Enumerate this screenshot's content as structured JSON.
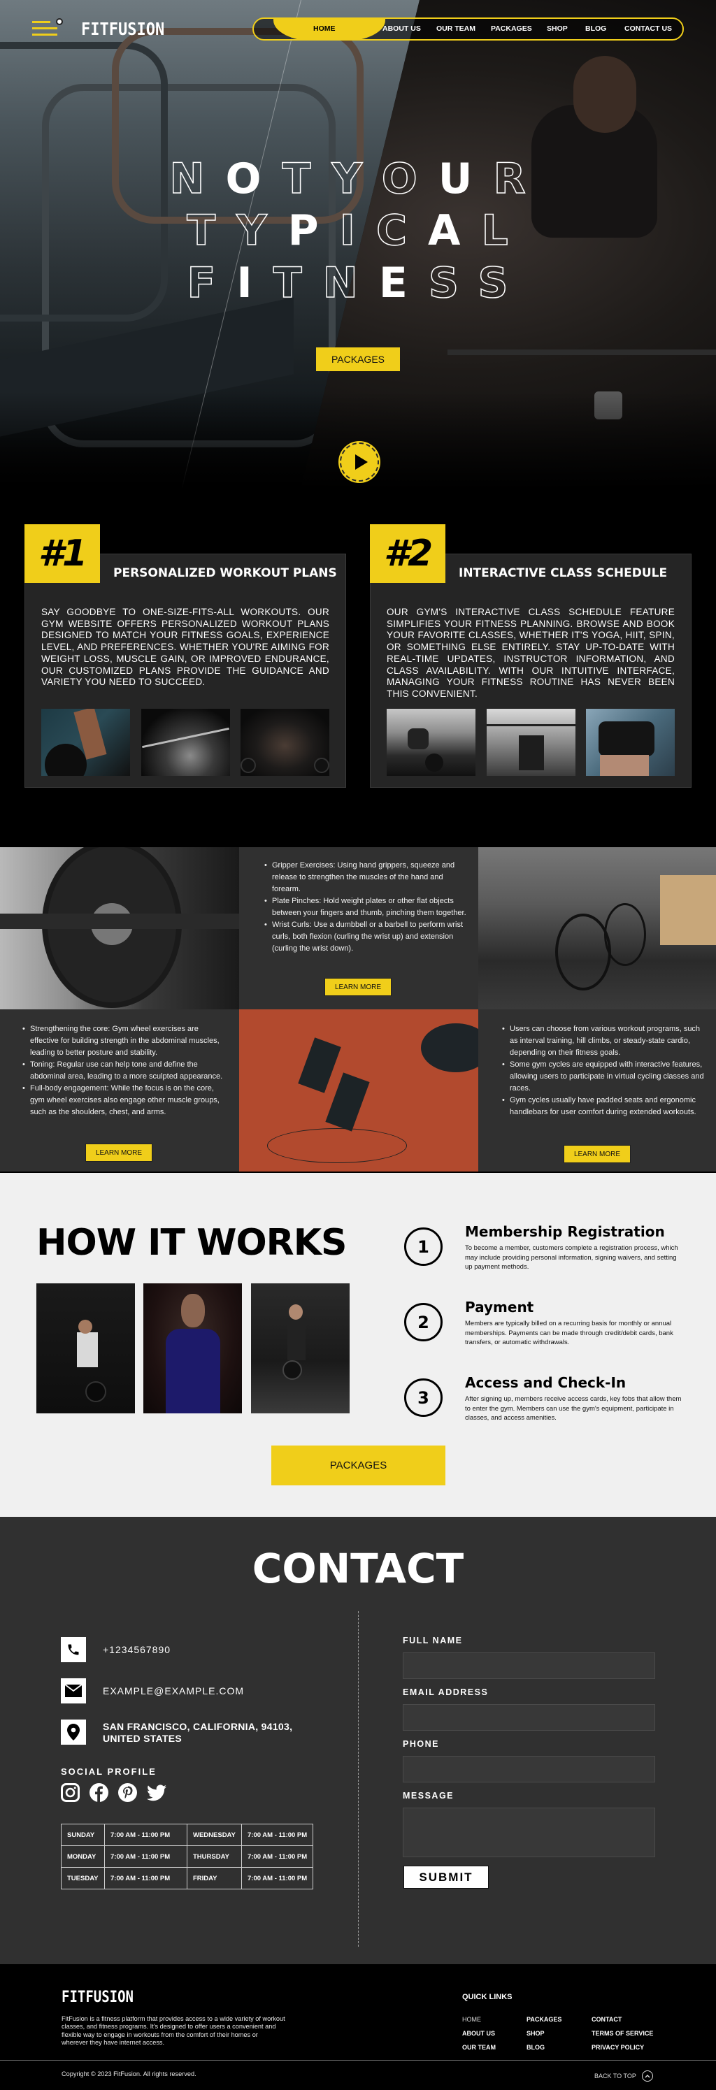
{
  "brand": {
    "name": "FITFUSION",
    "accent": "#f0ce1a"
  },
  "nav": {
    "items": [
      {
        "label": "HOME",
        "active": true
      },
      {
        "label": "ABOUT US",
        "active": false
      },
      {
        "label": "OUR TEAM",
        "active": false
      },
      {
        "label": "PACKAGES",
        "active": false
      },
      {
        "label": "SHOP",
        "active": false
      },
      {
        "label": "BLOG",
        "active": false
      },
      {
        "label": "CONTACT US",
        "active": false
      }
    ],
    "menu_icon": "hamburger-icon"
  },
  "hero": {
    "title_lines": [
      {
        "letters": [
          "N",
          "O",
          "T",
          "Y",
          "O",
          "U",
          "R"
        ],
        "filled": [
          false,
          true,
          false,
          false,
          false,
          true,
          false
        ]
      },
      {
        "letters": [
          "T",
          "Y",
          "P",
          "I",
          "C",
          "A",
          "L"
        ],
        "filled": [
          false,
          false,
          true,
          false,
          false,
          true,
          false
        ]
      },
      {
        "letters": [
          "F",
          "I",
          "T",
          "N",
          "E",
          "S",
          "S"
        ],
        "filled": [
          false,
          true,
          false,
          false,
          true,
          false,
          false
        ]
      }
    ],
    "cta_label": "PACKAGES",
    "play_icon": "play-icon"
  },
  "features": [
    {
      "number": "#1",
      "title": "PERSONALIZED WORKOUT PLANS",
      "description": "Say goodbye to one-size-fits-all workouts. Our gym website offers personalized workout plans designed to match your fitness goals, experience level, and preferences. Whether you're aiming for weight loss, muscle gain, or improved endurance, our customized plans provide the guidance and variety you need to succeed.",
      "images": [
        "deadlift-photo",
        "woman-barbell-photo",
        "man-lifting-photo"
      ]
    },
    {
      "number": "#2",
      "title": "INTERACTIVE CLASS SCHEDULE",
      "description": "Our gym's interactive class schedule feature simplifies your fitness planning. Browse and book your favorite classes, whether it's yoga, HIIT, spin, or something else entirely. Stay up-to-date with real-time updates, instructor information, and class availability. With our intuitive interface, managing your fitness routine has never been this convenient.",
      "images": [
        "deadlift-gym-photo",
        "bench-press-photo",
        "tattooed-woman-photo"
      ]
    }
  ],
  "grid": {
    "learn_more_label": "LEARN MORE",
    "panels": [
      {
        "position": "top-middle",
        "items": [
          "Gripper Exercises: Using hand grippers, squeeze and release to strengthen the muscles of the hand and forearm.",
          "Plate Pinches: Hold weight plates or other flat objects between your fingers and thumb, pinching them together.",
          "Wrist Curls: Use a dumbbell or a barbell to perform wrist curls, both flexion (curling the wrist up) and extension (curling the wrist down)."
        ]
      },
      {
        "position": "bottom-left",
        "items": [
          "Strengthening the core: Gym wheel exercises are effective for building strength in the abdominal muscles, leading to better posture and stability.",
          "Toning: Regular use can help tone and define the abdominal area, leading to a more sculpted appearance.",
          "Full-body engagement: While the focus is on the core, gym wheel exercises also engage other muscle groups, such as the shoulders, chest, and arms."
        ]
      },
      {
        "position": "bottom-right",
        "items": [
          "Users can choose from various workout programs, such as interval training, hill climbs, or steady-state cardio, depending on their fitness goals.",
          "Some gym cycles are equipped with interactive features, allowing users to participate in virtual cycling classes and races.",
          "Gym cycles usually have padded seats and ergonomic handlebars for user comfort during extended workouts."
        ]
      }
    ]
  },
  "how_it_works": {
    "title": "HOW IT WORKS",
    "steps": [
      {
        "number": "1",
        "title": "Membership Registration",
        "description": "To become a member, customers complete a registration process, which may include providing personal information, signing waivers, and setting up payment methods."
      },
      {
        "number": "2",
        "title": "Payment",
        "description": "Members are typically billed on a recurring basis for monthly or annual memberships. Payments can be made through credit/debit cards, bank transfers, or automatic withdrawals."
      },
      {
        "number": "3",
        "title": "Access and Check-In",
        "description": "After signing up, members receive access cards, key fobs that allow them to enter the gym. Members can use the gym's equipment, participate in classes, and access amenities."
      }
    ],
    "cta_label": "PACKAGES"
  },
  "contact": {
    "title": "CONTACT",
    "phone": "+1234567890",
    "email": "EXAMPLE@EXAMPLE.COM",
    "address_line1": "SAN FRANCISCO, CALIFORNIA, 94103,",
    "address_line2": "UNITED STATES",
    "social_label": "SOCIAL PROFILE",
    "social": [
      "instagram",
      "facebook",
      "pinterest",
      "twitter"
    ],
    "hours": [
      [
        "SUNDAY",
        "7:00 AM - 11:00 PM",
        "WEDNESDAY",
        "7:00 AM - 11:00 PM"
      ],
      [
        "MONDAY",
        "7:00 AM - 11:00 PM",
        "THURSDAY",
        "7:00 AM - 11:00 PM"
      ],
      [
        "TUESDAY",
        "7:00 AM - 11:00 PM",
        "FRIDAY",
        "7:00 AM - 11:00 PM"
      ]
    ],
    "form": {
      "full_name_label": "FULL NAME",
      "email_label": "EMAIL ADDRESS",
      "phone_label": "PHONE",
      "message_label": "MESSAGE",
      "full_name_value": "",
      "email_value": "",
      "phone_value": "",
      "message_value": "",
      "submit_label": "SUBMIT"
    }
  },
  "footer": {
    "brand": "FITFUSION",
    "description": "FitFusion is a fitness platform that provides access to a wide variety of workout classes, and fitness programs. It's designed to offer users a convenient and flexible way to engage in workouts from the comfort of their homes or wherever they have internet access.",
    "quick_links_title": "QUICK LINKS",
    "quick_links": [
      [
        "HOME",
        "ABOUT US",
        "OUR TEAM"
      ],
      [
        "PACKAGES",
        "SHOP",
        "BLOG"
      ],
      [
        "CONTACT",
        "TERMS OF SERVICE",
        "PRIVACY POLICY"
      ]
    ],
    "copyright": "Copyright © 2023 FitFusion. All rights reserved.",
    "back_to_top": "BACK TO TOP"
  }
}
